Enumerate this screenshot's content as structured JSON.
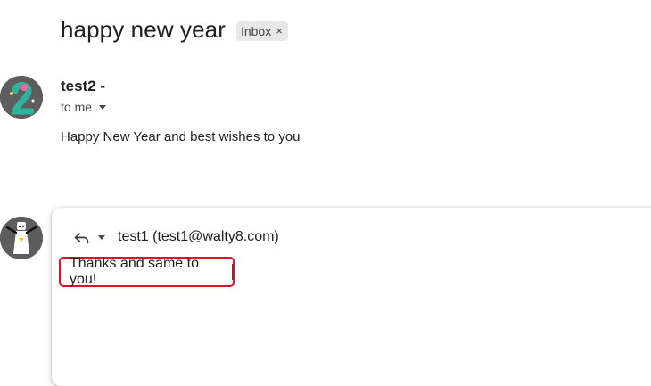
{
  "thread": {
    "subject": "happy new year",
    "label": "Inbox",
    "label_remove_icon": "×"
  },
  "message": {
    "sender": "test2 -",
    "recipient": "to me",
    "body": "Happy New Year and best wishes to you"
  },
  "reply": {
    "to": "test1 (test1@walty8.com)",
    "draft_text": "Thanks and same to you!",
    "icons": [
      "reply-icon",
      "chevron-down-icon"
    ]
  },
  "colors": {
    "highlight_border": "#e0102a",
    "chip_bg": "#e8e8e8"
  }
}
